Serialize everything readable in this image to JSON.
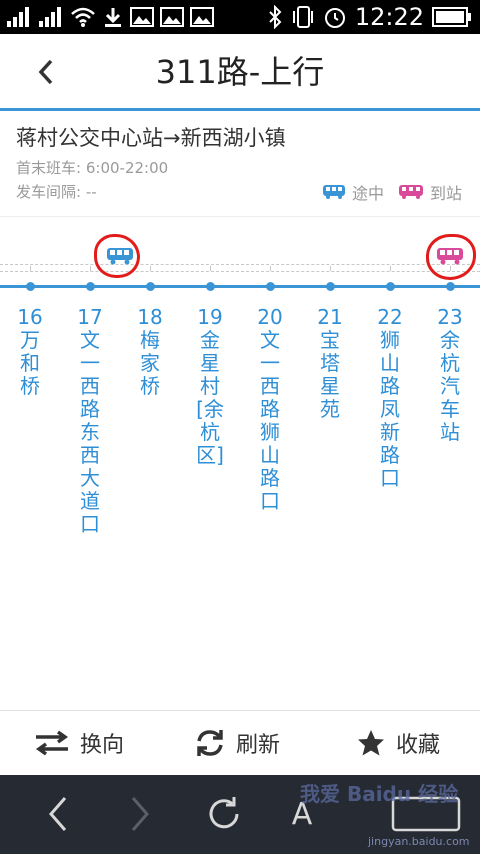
{
  "status_bar": {
    "time": "12:22",
    "icons": [
      "signal-icon",
      "signal-icon",
      "wifi-icon",
      "download-icon",
      "image-icon",
      "image-icon",
      "image-icon",
      "bluetooth-icon",
      "vibrate-icon",
      "alarm-icon",
      "battery-icon"
    ]
  },
  "header": {
    "title": "311路-上行",
    "back_icon": "chevron-left-icon"
  },
  "route": {
    "name": "蒋村公交中心站→新西湖小镇",
    "first_last_label": "首末班车:",
    "first_last_value": "6:00-22:00",
    "interval_label": "发车间隔:",
    "interval_value": "--"
  },
  "legend": {
    "en_route": "途中",
    "arrived": "到站"
  },
  "stops": [
    {
      "num": "16",
      "name": "万和桥"
    },
    {
      "num": "17",
      "name": "文一西路东西大道口"
    },
    {
      "num": "18",
      "name": "梅家桥"
    },
    {
      "num": "19",
      "name": "金星村[余杭区]"
    },
    {
      "num": "20",
      "name": "文一西路狮山路口"
    },
    {
      "num": "21",
      "name": "宝塔星苑"
    },
    {
      "num": "22",
      "name": "狮山路凤新路口"
    },
    {
      "num": "23",
      "name": "余杭汽车站"
    }
  ],
  "toolbar": {
    "switch": "换向",
    "refresh": "刷新",
    "favorite": "收藏"
  },
  "colors": {
    "accent": "#3a95d6",
    "arrived": "#d94b9a",
    "annotation": "#e21b1b",
    "nav_bg": "#262a33"
  },
  "watermark": {
    "brand": "我爱 Baidu 经验",
    "url": "jingyan.baidu.com"
  },
  "browser_nav": {
    "font_button": "A"
  }
}
